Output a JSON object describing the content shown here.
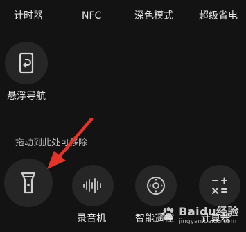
{
  "top_row": [
    "计时器",
    "NFC",
    "深色模式",
    "超级省电"
  ],
  "floating_nav": {
    "label": "悬浮导航",
    "icon": "phone-back-icon"
  },
  "drag_hint": "拖动到此处可移除",
  "bottom_row": [
    {
      "label": "",
      "icon": "flashlight-icon"
    },
    {
      "label": "录音机",
      "icon": "waveform-icon"
    },
    {
      "label": "智能遥控",
      "icon": "remote-dpad-icon"
    },
    {
      "label": "计算器",
      "icon": "calculator-icon"
    }
  ],
  "watermark": {
    "brand": "Baidu经验",
    "sub": "jingyan.baidu.com"
  },
  "colors": {
    "background": "#131313",
    "tile": "#262626",
    "arrow": "#e5332a"
  }
}
